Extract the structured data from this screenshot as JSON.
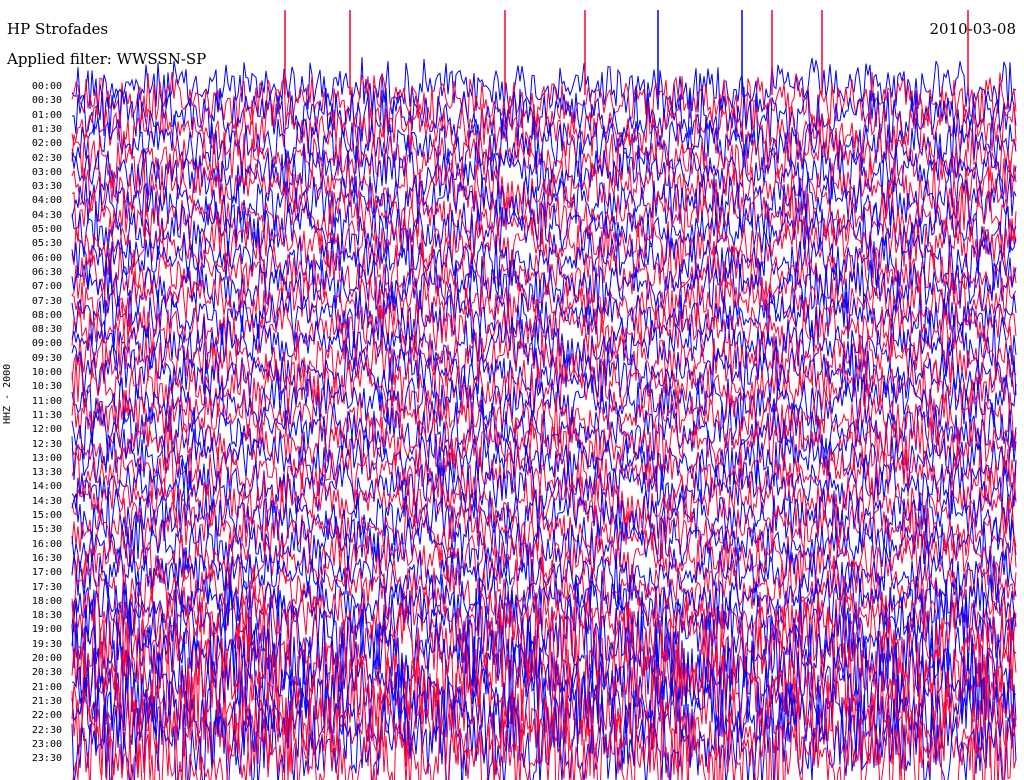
{
  "header": {
    "station": "HP Strofades",
    "filter": "Applied filter: WWSSN-SP",
    "date": "2010-03-08"
  },
  "chart_data": {
    "type": "line",
    "channel_label": "HHZ - 2000",
    "rows": [
      "00:00",
      "00:30",
      "01:00",
      "01:30",
      "02:00",
      "02:30",
      "03:00",
      "03:30",
      "04:00",
      "04:30",
      "05:00",
      "05:30",
      "06:00",
      "06:30",
      "07:00",
      "07:30",
      "08:00",
      "08:30",
      "09:00",
      "09:30",
      "10:00",
      "10:30",
      "11:00",
      "11:30",
      "12:00",
      "12:30",
      "13:00",
      "13:30",
      "14:00",
      "14:30",
      "15:00",
      "15:30",
      "16:00",
      "16:30",
      "17:00",
      "17:30",
      "18:00",
      "18:30",
      "19:00",
      "19:30",
      "20:00",
      "20:30",
      "21:00",
      "21:30",
      "22:00",
      "22:30",
      "23:00",
      "23:30"
    ],
    "series": [
      {
        "color": "#0000ff"
      },
      {
        "color": "#ff0033"
      }
    ],
    "grid": false
  }
}
